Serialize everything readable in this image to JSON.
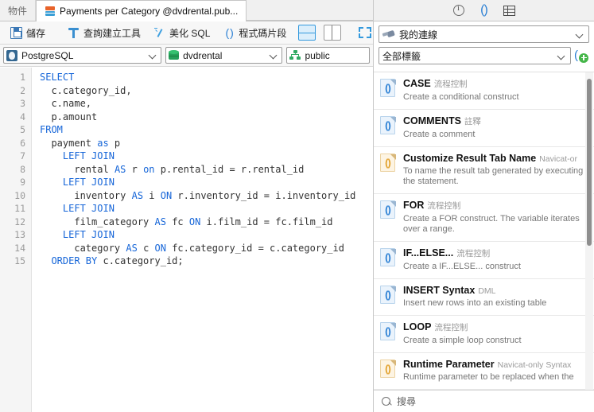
{
  "tabs": [
    {
      "label": "物件",
      "active": false,
      "icon": "none"
    },
    {
      "label": "Payments per Category @dvdrental.pub...",
      "active": true,
      "icon": "query-icon"
    }
  ],
  "toolbar": {
    "save_label": "儲存",
    "query_builder_label": "查詢建立工具",
    "beautify_label": "美化 SQL",
    "snippet_label": "程式碼片段",
    "split_horizontal": "horizontal-split-icon",
    "split_vertical": "vertical-split-icon",
    "fullscreen": "fullscreen-icon"
  },
  "connection_bar": {
    "server_type": "PostgreSQL",
    "database": "dvdrental",
    "schema": "public"
  },
  "editor": {
    "line_numbers": [
      "1",
      "2",
      "3",
      "4",
      "5",
      "6",
      "7",
      "8",
      "9",
      "10",
      "11",
      "12",
      "13",
      "14",
      "15"
    ],
    "lines": [
      [
        {
          "t": "SELECT",
          "c": "k"
        }
      ],
      [
        {
          "t": "  ",
          "c": "p"
        },
        {
          "t": "c.category_id,",
          "c": "id"
        }
      ],
      [
        {
          "t": "  ",
          "c": "p"
        },
        {
          "t": "c.name,",
          "c": "id"
        }
      ],
      [
        {
          "t": "  ",
          "c": "p"
        },
        {
          "t": "p.amount",
          "c": "id"
        }
      ],
      [
        {
          "t": "FROM",
          "c": "k"
        }
      ],
      [
        {
          "t": "  ",
          "c": "p"
        },
        {
          "t": "payment ",
          "c": "id"
        },
        {
          "t": "as",
          "c": "k"
        },
        {
          "t": " p",
          "c": "id"
        }
      ],
      [
        {
          "t": "    ",
          "c": "p"
        },
        {
          "t": "LEFT JOIN",
          "c": "k"
        }
      ],
      [
        {
          "t": "      ",
          "c": "p"
        },
        {
          "t": "rental ",
          "c": "id"
        },
        {
          "t": "AS",
          "c": "k"
        },
        {
          "t": " r ",
          "c": "id"
        },
        {
          "t": "on",
          "c": "k"
        },
        {
          "t": " p.rental_id = r.rental_id",
          "c": "id"
        }
      ],
      [
        {
          "t": "    ",
          "c": "p"
        },
        {
          "t": "LEFT JOIN",
          "c": "k"
        }
      ],
      [
        {
          "t": "      ",
          "c": "p"
        },
        {
          "t": "inventory ",
          "c": "id"
        },
        {
          "t": "AS",
          "c": "k"
        },
        {
          "t": " i ",
          "c": "id"
        },
        {
          "t": "ON",
          "c": "k"
        },
        {
          "t": " r.inventory_id = i.inventory_id",
          "c": "id"
        }
      ],
      [
        {
          "t": "    ",
          "c": "p"
        },
        {
          "t": "LEFT JOIN",
          "c": "k"
        }
      ],
      [
        {
          "t": "      ",
          "c": "p"
        },
        {
          "t": "film_category ",
          "c": "id"
        },
        {
          "t": "AS",
          "c": "k"
        },
        {
          "t": " fc ",
          "c": "id"
        },
        {
          "t": "ON",
          "c": "k"
        },
        {
          "t": " i.film_id = fc.film_id",
          "c": "id"
        }
      ],
      [
        {
          "t": "    ",
          "c": "p"
        },
        {
          "t": "LEFT JOIN",
          "c": "k"
        }
      ],
      [
        {
          "t": "      ",
          "c": "p"
        },
        {
          "t": "category ",
          "c": "id"
        },
        {
          "t": "AS",
          "c": "k"
        },
        {
          "t": " c ",
          "c": "id"
        },
        {
          "t": "ON",
          "c": "k"
        },
        {
          "t": " fc.category_id = c.category_id",
          "c": "id"
        }
      ],
      [
        {
          "t": "  ",
          "c": "p"
        },
        {
          "t": "ORDER BY",
          "c": "k"
        },
        {
          "t": " c.category_id;",
          "c": "id"
        }
      ]
    ]
  },
  "right_panel": {
    "header_icons": [
      "info-icon",
      "code-snippet-icon",
      "grid-icon"
    ],
    "connection_filter": "我的連線",
    "tag_filter": "全部標籤",
    "add_snippet_icon": "add-snippet-icon",
    "snippets": [
      {
        "title": "CASE",
        "tag": "流程控制",
        "desc": "Create a conditional construct",
        "color": "blue"
      },
      {
        "title": "COMMENTS",
        "tag": "註釋",
        "desc": "Create a comment",
        "color": "blue"
      },
      {
        "title": "Customize Result Tab Name",
        "tag": "Navicat-or",
        "desc": "To name the result tab generated by executing the statement.",
        "color": "orange"
      },
      {
        "title": "FOR",
        "tag": "流程控制",
        "desc": "Create a FOR construct. The variable iterates over a range.",
        "color": "blue"
      },
      {
        "title": "IF...ELSE...",
        "tag": "流程控制",
        "desc": "Create a IF...ELSE... construct",
        "color": "blue"
      },
      {
        "title": "INSERT Syntax",
        "tag": "DML",
        "desc": "Insert new rows into an existing table",
        "color": "blue"
      },
      {
        "title": "LOOP",
        "tag": "流程控制",
        "desc": "Create a simple loop construct",
        "color": "blue"
      },
      {
        "title": "Runtime Parameter",
        "tag": "Navicat-only Syntax",
        "desc": "Runtime parameter to be replaced when the",
        "color": "orange"
      }
    ],
    "search_placeholder": "搜尋"
  },
  "colors": {
    "accent_blue": "#2a7fd4",
    "keyword_blue": "#1565d8",
    "orange": "#e2a12c",
    "green": "#45b649"
  }
}
